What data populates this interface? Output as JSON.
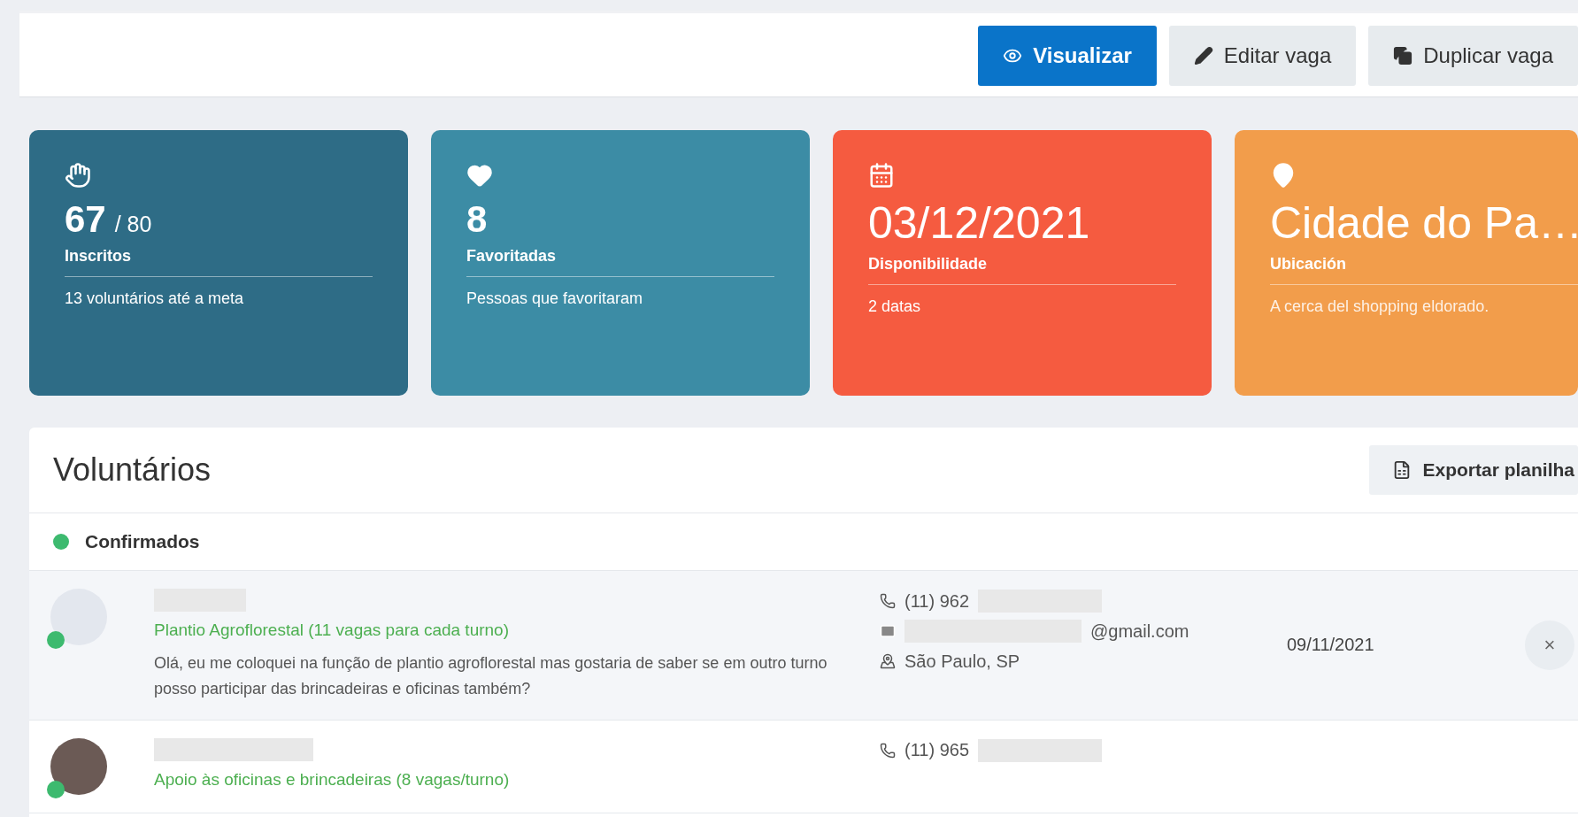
{
  "toolbar": {
    "buttons": [
      {
        "label": "Visualizar",
        "kind": "view"
      },
      {
        "label": "Editar vaga",
        "kind": "edit"
      },
      {
        "label": "Duplicar vaga",
        "kind": "duplicate"
      }
    ]
  },
  "stats": [
    {
      "kind": "enrolled",
      "color": "#2e6c86",
      "value": "67",
      "total": "/ 80",
      "label": "Inscritos",
      "note": "13 voluntários até a meta"
    },
    {
      "kind": "favorites",
      "color": "#3c8ca5",
      "value": "8",
      "label": "Favoritadas",
      "note": "Pessoas que favoritaram"
    },
    {
      "kind": "availability",
      "color": "#f55b40",
      "value": "03/12/2021",
      "label": "Disponibilidade",
      "note": "2 datas"
    },
    {
      "kind": "location",
      "color": "#f29d4b",
      "value": "Cidade do Pa…",
      "label": "Ubicación",
      "note": "A cerca del shopping eldorado."
    }
  ],
  "volunteers": {
    "title": "Voluntários",
    "export_button": "Exportar planilha",
    "groups": [
      {
        "label": "Confirmados",
        "color": "#3dba6f",
        "rows": [
          {
            "kind": "no_photo",
            "online": true,
            "role": "Plantio Agroflorestal (11 vagas para cada turno)",
            "message": "Olá, eu me coloquei na função de plantio agroflorestal mas gostaria de saber se em outro turno posso participar das brincadeiras e oficinas também?",
            "phone": "(11) 962",
            "email": "@gmail.com",
            "location": "São Paulo, SP",
            "date": "09/11/2021",
            "remove": "×"
          },
          {
            "kind": "photo",
            "online": true,
            "role": "Apoio às oficinas e brincadeiras (8 vagas/turno)",
            "phone": "(11) 965"
          }
        ]
      }
    ]
  }
}
